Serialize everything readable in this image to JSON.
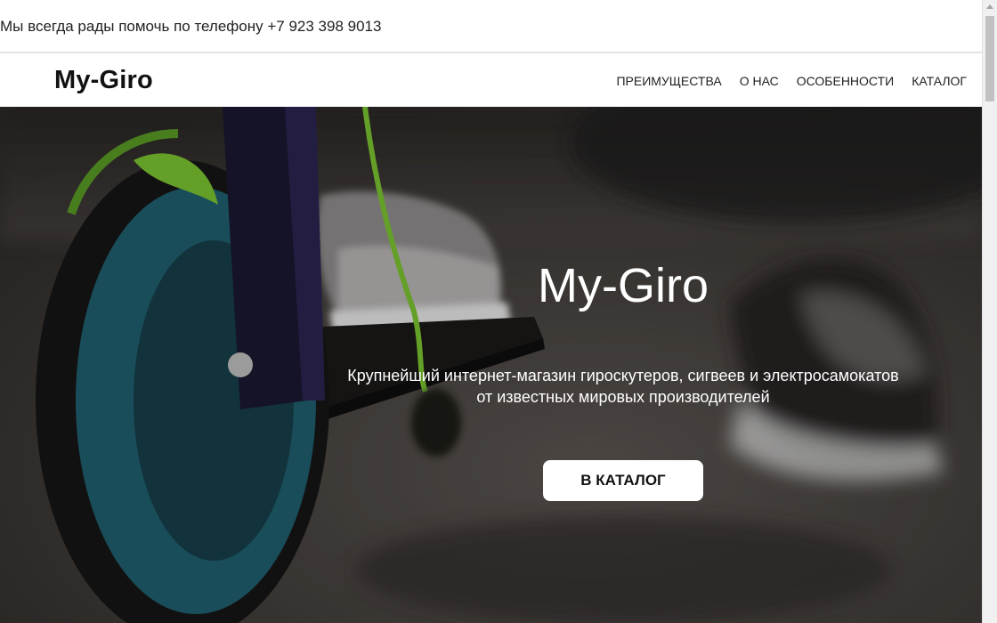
{
  "topbar": {
    "text": "Мы всегда рады помочь по телефону +7 923 398 9013"
  },
  "header": {
    "logo": "My-Giro",
    "nav": [
      {
        "label": "ПРЕИМУЩЕСТВА"
      },
      {
        "label": "О НАС"
      },
      {
        "label": "ОСОБЕННОСТИ"
      },
      {
        "label": "КАТАЛОГ"
      }
    ]
  },
  "hero": {
    "title": "My-Giro",
    "subtitle_line1": "Крупнейший интернет-магазин гироскутеров, сигвеев и электросамокатов",
    "subtitle_line2": "от известных мировых производителей",
    "cta_label": "В КАТАЛОГ",
    "background_image": "blurred-scooter-wheel-and-sneakers-photo"
  },
  "colors": {
    "topbar_border": "#dfe3e6",
    "hero_dark": "#3d3a37",
    "scooter_green": "#7ac231",
    "wheel_teal": "#1f5f6e"
  }
}
